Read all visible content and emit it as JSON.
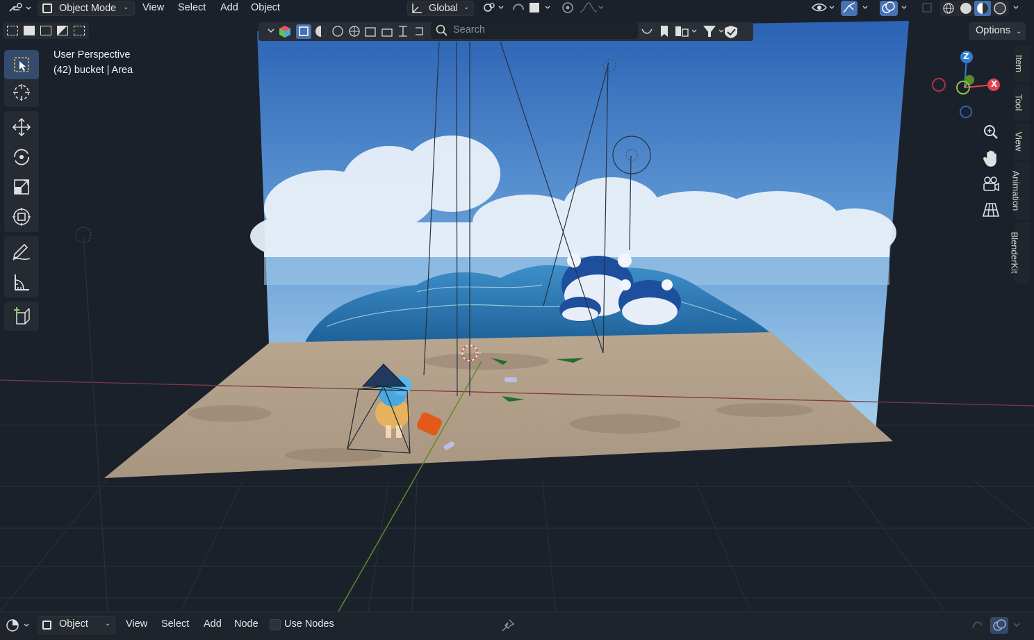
{
  "header": {
    "mode_label": "Object Mode",
    "menu": [
      "View",
      "Select",
      "Add",
      "Object"
    ],
    "transform_orientation": "Global"
  },
  "viewport_subheader": {
    "search_placeholder": "Search"
  },
  "options_label": "Options",
  "overlay": {
    "perspective": "User Perspective",
    "object_info": "(42) bucket | Area"
  },
  "gizmo": {
    "z": "Z",
    "x": "X"
  },
  "sidebar_tabs": [
    "Item",
    "Tool",
    "View",
    "Animation",
    "BlenderKit"
  ],
  "footer": {
    "object_label": "Object",
    "menu": [
      "View",
      "Select",
      "Add",
      "Node"
    ],
    "use_nodes_label": "Use Nodes"
  },
  "colors": {
    "accent": "#4772b3",
    "x_axis": "#e0434f",
    "y_axis": "#8bc34a",
    "z_axis": "#2f7fd1"
  }
}
